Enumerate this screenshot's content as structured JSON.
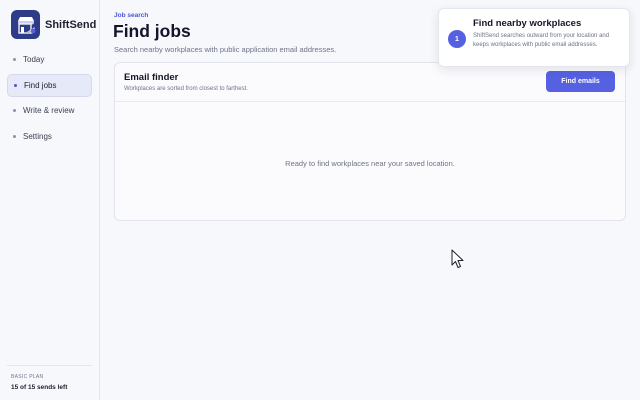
{
  "brand": {
    "name": "ShiftSend",
    "logo_icon": "storefront-send-icon"
  },
  "sidebar": {
    "items": [
      {
        "label": "Today",
        "active": false
      },
      {
        "label": "Find jobs",
        "active": true
      },
      {
        "label": "Write & review",
        "active": false
      },
      {
        "label": "Settings",
        "active": false
      }
    ],
    "plan": {
      "label": "BASIC PLAN",
      "value": "15 of 15 sends left"
    }
  },
  "header": {
    "eyebrow": "Job search",
    "title": "Find jobs",
    "subtitle": "Search nearby workplaces with public application email addresses."
  },
  "finder": {
    "title": "Email finder",
    "description": "Workplaces are sorted from closest to farthest.",
    "button_label": "Find emails",
    "empty_text": "Ready to find workplaces near your saved location."
  },
  "toast": {
    "step": "1",
    "title": "Find nearby workplaces",
    "body": "ShiftSend searches outward from your location and keeps workplaces with public email addresses."
  },
  "colors": {
    "accent": "#5661e2",
    "brand_dark": "#2f3b87",
    "active_bg": "#e6e9f8"
  }
}
